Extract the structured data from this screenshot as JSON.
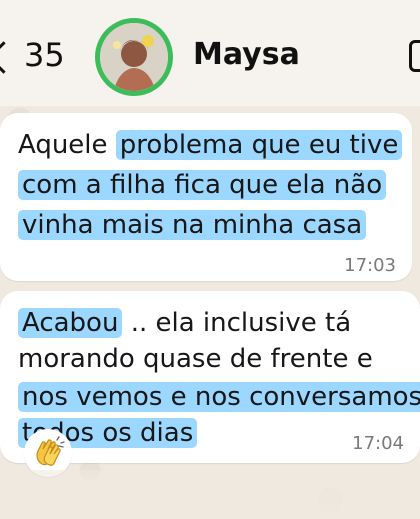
{
  "header": {
    "back_count": "35",
    "contact_name": "Maysa"
  },
  "messages": [
    {
      "lines": [
        {
          "plain": "Aquele ",
          "highlight": "problema que eu tive"
        },
        {
          "plain": "",
          "highlight": "com a filha fica que ela não"
        },
        {
          "plain": "",
          "highlight": "vinha mais na minha casa"
        }
      ],
      "time": "17:03"
    },
    {
      "lines": [
        {
          "plain": "",
          "highlight": "Acabou",
          "tail": " .. ela inclusive tá"
        },
        {
          "plain": "morando quase de frente e",
          "highlight": ""
        },
        {
          "plain": "",
          "highlight": "nos vemos e nos conversamos"
        },
        {
          "plain": "",
          "highlight": "todos os dias"
        }
      ],
      "time": "17:04"
    }
  ],
  "reaction": {
    "icon": "clapping-hands-icon"
  },
  "colors": {
    "highlight": "#53baff",
    "online_ring": "#3dbd5a"
  }
}
